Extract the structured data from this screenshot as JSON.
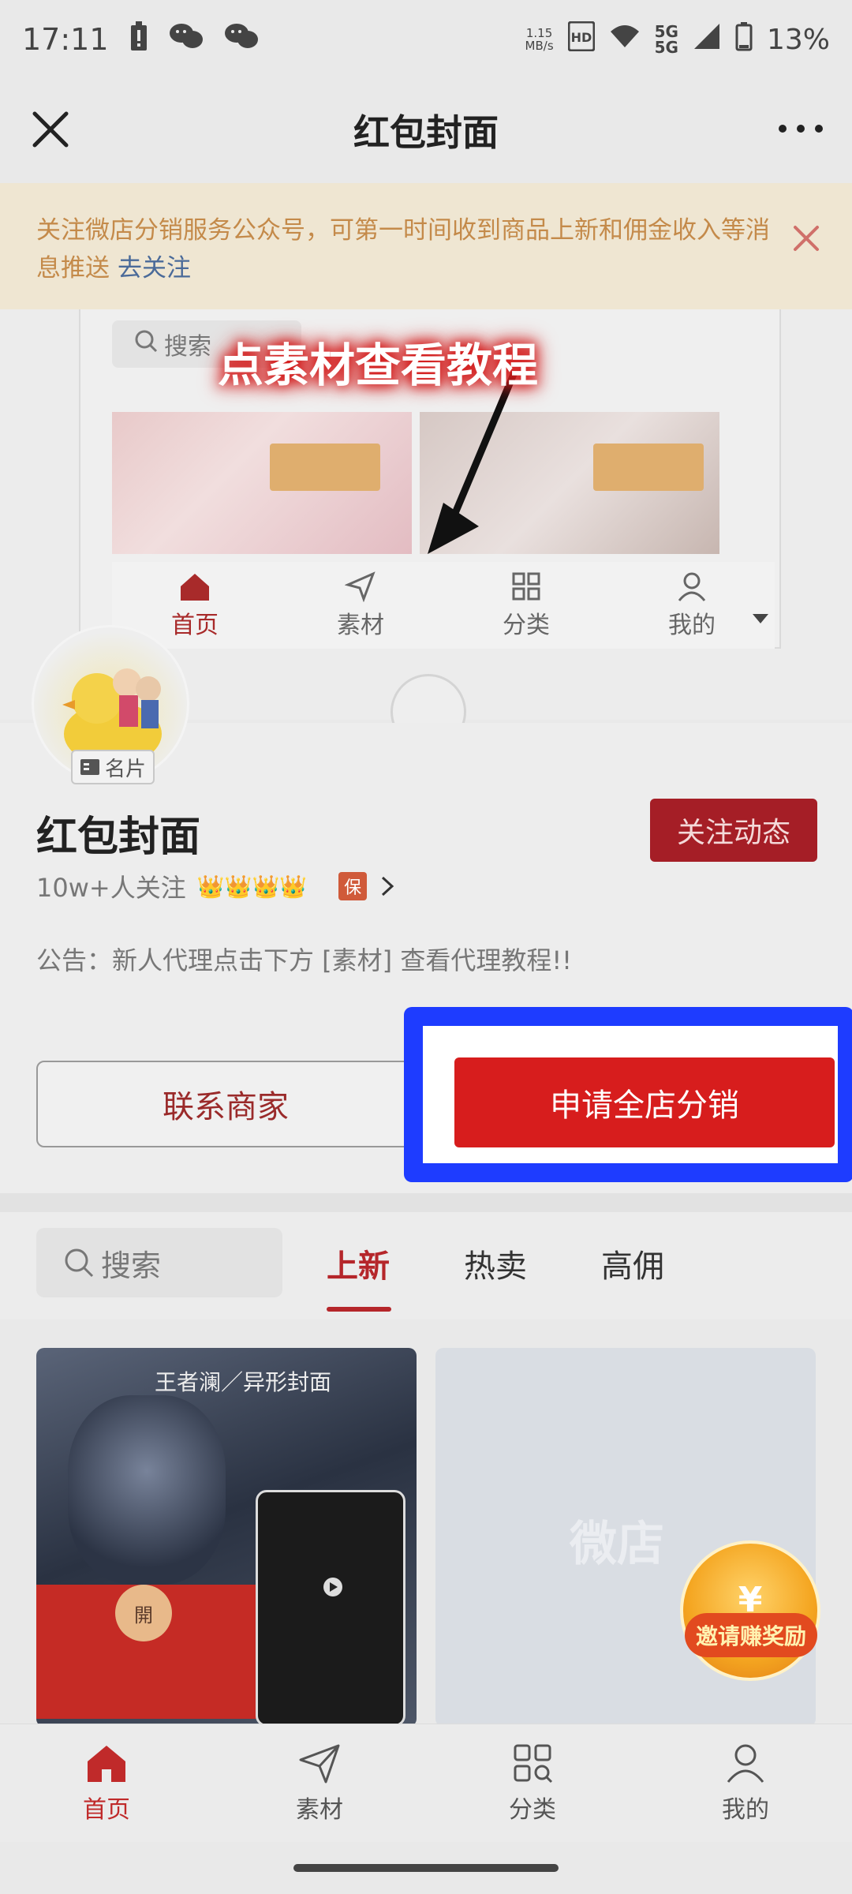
{
  "status_bar": {
    "time": "17:11",
    "net_speed_value": "1.15",
    "net_speed_unit": "MB/s",
    "hd_badge": "HD",
    "signal_1": "5G",
    "signal_2": "5G",
    "battery_percent": "13%"
  },
  "title_bar": {
    "title": "红包封面"
  },
  "notice": {
    "text": "关注微店分销服务公众号，可第一时间收到商品上新和佣金收入等消息推送",
    "link": "去关注"
  },
  "banner": {
    "search_text": "搜索",
    "tutorial_label": "点素材查看教程",
    "mini_tabs": [
      "首页",
      "素材",
      "分类",
      "我的"
    ]
  },
  "shop": {
    "card_badge": "名片",
    "name": "红包封面",
    "follow_button": "关注动态",
    "followers": "10w+人关注",
    "crowns": "👑👑👑👑",
    "guarantee_badge": "保",
    "announcement": "公告：新人代理点击下方 [素材] 查看代理教程!!",
    "contact_button": "联系商家",
    "apply_button": "申请全店分销"
  },
  "goods": {
    "search_placeholder": "搜索",
    "tabs": [
      "上新",
      "热卖",
      "高佣"
    ],
    "product_a_caption": "王者澜／异形封面",
    "product_a_open": "開",
    "product_b_watermark": "微店",
    "invite_label": "邀请赚奖励"
  },
  "bottom_nav": {
    "items": [
      "首页",
      "素材",
      "分类",
      "我的"
    ]
  },
  "colors": {
    "brand_red": "#d71d1d",
    "highlight_blue": "#1e3cff",
    "active_tab": "#b5262a"
  }
}
